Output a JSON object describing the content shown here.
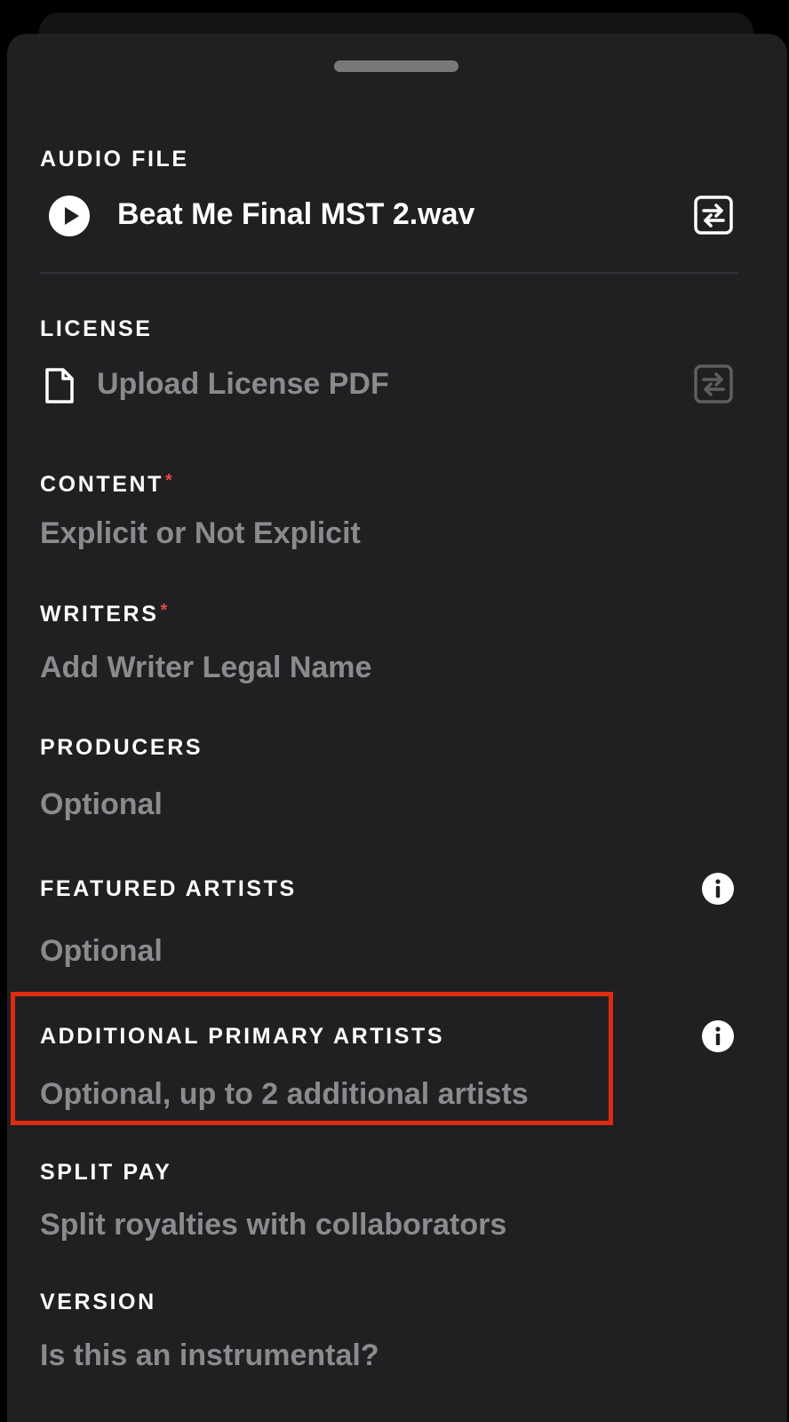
{
  "audio_file": {
    "label": "AUDIO FILE",
    "file_name": "Beat Me Final MST 2.wav"
  },
  "license": {
    "label": "LICENSE",
    "placeholder": "Upload License PDF"
  },
  "content": {
    "label": "CONTENT",
    "required_mark": "*",
    "placeholder": "Explicit or Not Explicit"
  },
  "writers": {
    "label": "WRITERS",
    "required_mark": "*",
    "placeholder": "Add Writer Legal Name"
  },
  "producers": {
    "label": "PRODUCERS",
    "placeholder": "Optional"
  },
  "featured_artists": {
    "label": "FEATURED ARTISTS",
    "placeholder": "Optional"
  },
  "additional_primary_artists": {
    "label": "ADDITIONAL PRIMARY ARTISTS",
    "placeholder": "Optional, up to 2 additional artists"
  },
  "split_pay": {
    "label": "SPLIT PAY",
    "placeholder": "Split royalties with collaborators"
  },
  "version": {
    "label": "VERSION",
    "placeholder": "Is this an instrumental?"
  },
  "icons": {
    "play": "play-icon",
    "document": "document-icon",
    "replace": "swap-icon",
    "info": "info-icon"
  },
  "colors": {
    "background": "#211f22",
    "label": "#ffffff",
    "placeholder": "#8b8a8d",
    "required": "#e24a45",
    "highlight": "#de2b12"
  }
}
